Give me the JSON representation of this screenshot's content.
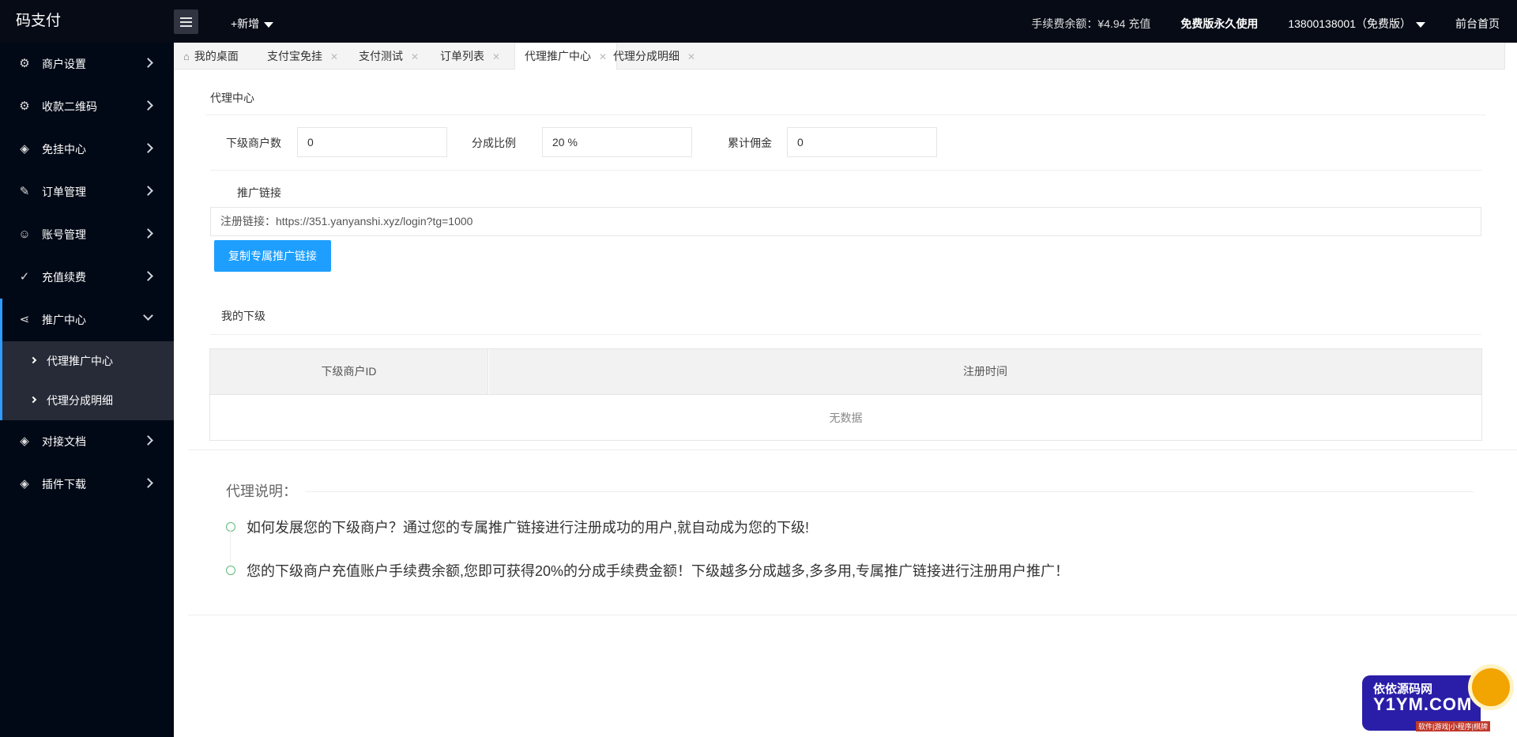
{
  "header": {
    "logo": "码支付",
    "new_label": "+新增",
    "fee_balance": "手续费余额：¥4.94 充值",
    "free_label": "免费版永久使用",
    "user_label": "13800138001（免费版）",
    "front_label": "前台首页"
  },
  "sidebar": {
    "items": [
      {
        "label": "商户设置",
        "icon": "gear-icon"
      },
      {
        "label": "收款二维码",
        "icon": "gear-icon"
      },
      {
        "label": "免挂中心",
        "icon": "cube-icon"
      },
      {
        "label": "订单管理",
        "icon": "edit-icon"
      },
      {
        "label": "账号管理",
        "icon": "user-icon"
      },
      {
        "label": "充值续费",
        "icon": "vine-icon"
      },
      {
        "label": "推广中心",
        "icon": "share-icon"
      },
      {
        "label": "对接文档",
        "icon": "cube-icon"
      },
      {
        "label": "插件下载",
        "icon": "cube-icon"
      }
    ],
    "sub_items": [
      {
        "label": "代理推广中心"
      },
      {
        "label": "代理分成明细"
      }
    ]
  },
  "tabs": [
    {
      "label": "我的桌面"
    },
    {
      "label": "支付宝免挂"
    },
    {
      "label": "支付测试"
    },
    {
      "label": "订单列表"
    },
    {
      "label": "代理推广中心"
    },
    {
      "label": "代理分成明细"
    }
  ],
  "main": {
    "panel_title": "代理中心",
    "fields": {
      "sub_count_label": "下级商户数",
      "sub_count_value": "0",
      "ratio_label": "分成比例",
      "ratio_value": "20 %",
      "commission_label": "累计佣金",
      "commission_value": "0"
    },
    "promo_label": "推广链接",
    "register_link": "注册链接：https://351.yanyanshi.xyz/login?tg=1000",
    "copy_button": "复制专属推广链接",
    "subs_title": "我的下级",
    "table": {
      "headers": [
        "下级商户ID",
        "注册时间"
      ],
      "empty_text": "无数据"
    },
    "notes_title": "代理说明：",
    "notes": [
      "如何发展您的下级商户？通过您的专属推广链接进行注册成功的用户,就自动成为您的下级!",
      "您的下级商户充值账户手续费余额,您即可获得20%的分成手续费金额！下级越多分成越多,多多用,专属推广链接进行注册用户推广！"
    ]
  },
  "watermark": {
    "line1": "依依源码网",
    "line2": "Y1YM.COM",
    "line3": "软件|游戏|小程序|棋牌"
  },
  "colors": {
    "sidebar_bg": "#020916",
    "accent": "#1e9fff",
    "active_border": "#2e9bff",
    "submenu_bg": "#262b37"
  }
}
